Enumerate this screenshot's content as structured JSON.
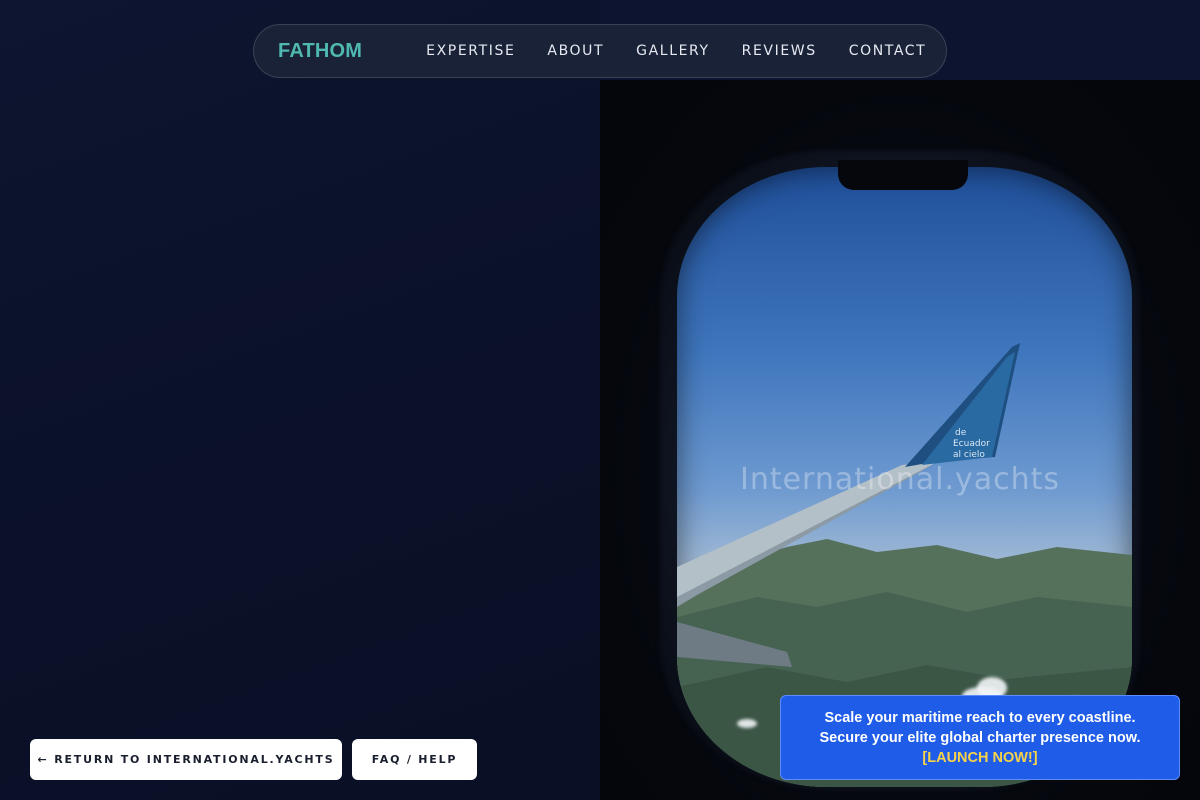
{
  "nav": {
    "logo": "FATHOM",
    "links": [
      "EXPERTISE",
      "ABOUT",
      "GALLERY",
      "REVIEWS",
      "CONTACT"
    ]
  },
  "hero": {
    "overlay_text": "International.yachts",
    "image_description_icon": "airplane-window-image"
  },
  "buttons": {
    "return_label": "← RETURN TO INTERNATIONAL.YACHTS",
    "faq_label": "FAQ / HELP"
  },
  "promo": {
    "line1": "Scale your maritime reach to every coastline.",
    "line2": "Secure your elite global charter presence now.",
    "cta": "[LAUNCH NOW!]"
  },
  "colors": {
    "background": "#0b1226",
    "logo": "#4fb8b0",
    "promo_bg": "#1f5ce8",
    "promo_cta": "#f7d34a"
  }
}
